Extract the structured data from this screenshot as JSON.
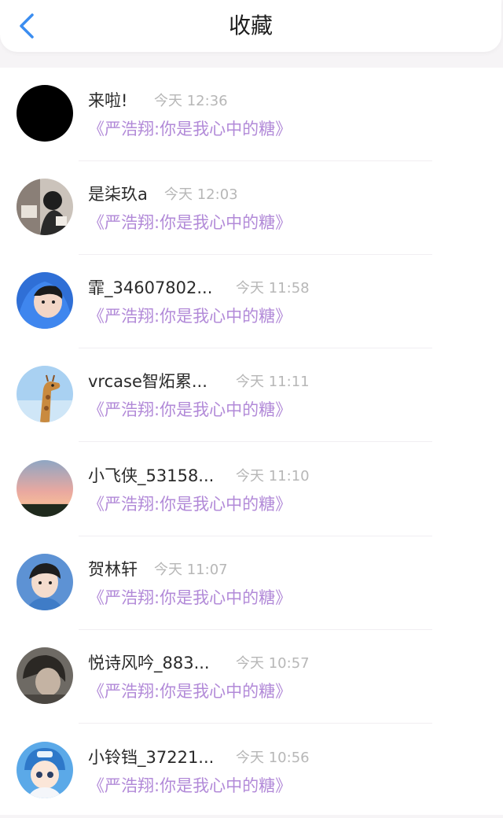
{
  "header": {
    "title": "收藏",
    "back_icon": "chevron-left-icon",
    "accent": "#3b8df0"
  },
  "items": [
    {
      "name": "来啦!",
      "time": "今天 12:36",
      "content": "《严浩翔:你是我心中的糖》"
    },
    {
      "name": "是柒玖a",
      "time": "今天 12:03",
      "content": "《严浩翔:你是我心中的糖》"
    },
    {
      "name": "霏_34607802...",
      "time": "今天 11:58",
      "content": "《严浩翔:你是我心中的糖》"
    },
    {
      "name": "vrcase智炻累...",
      "time": "今天 11:11",
      "content": "《严浩翔:你是我心中的糖》"
    },
    {
      "name": "小飞侠_53158...",
      "time": "今天 11:10",
      "content": "《严浩翔:你是我心中的糖》"
    },
    {
      "name": "贺林轩",
      "time": "今天 11:07",
      "content": "《严浩翔:你是我心中的糖》"
    },
    {
      "name": "悦诗风吟_883...",
      "time": "今天 10:57",
      "content": "《严浩翔:你是我心中的糖》"
    },
    {
      "name": "小铃铛_37221...",
      "time": "今天 10:56",
      "content": "《严浩翔:你是我心中的糖》"
    }
  ],
  "colors": {
    "content": "#b28ad8",
    "time": "#b7b7b7",
    "name": "#2a2a2a"
  }
}
